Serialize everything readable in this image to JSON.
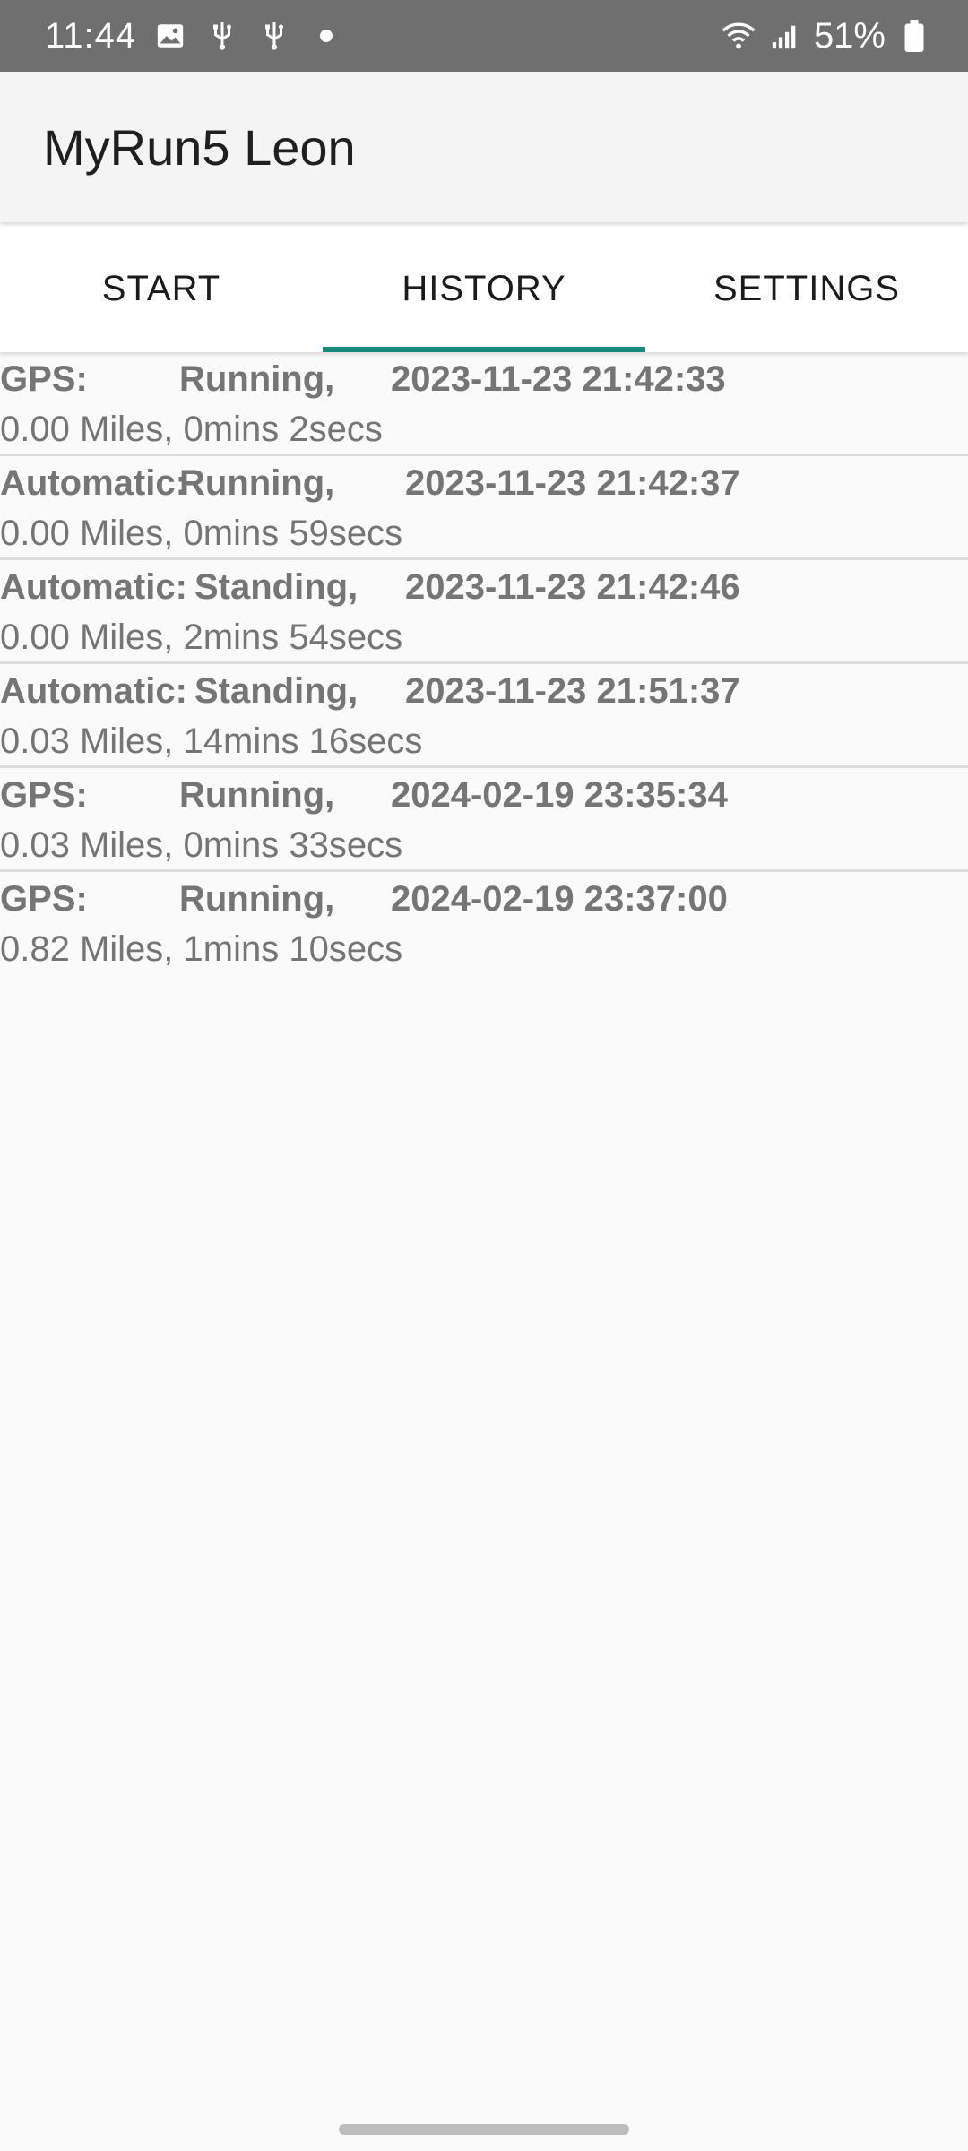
{
  "status_bar": {
    "time": "11:44",
    "battery": "51%",
    "icons": [
      "image-icon",
      "usb-icon",
      "usb-icon",
      "dot-icon",
      "wifi-icon",
      "signal-icon",
      "battery-icon"
    ]
  },
  "app_bar": {
    "title": "MyRun5 Leon"
  },
  "tabs": [
    {
      "label": "START",
      "active": false
    },
    {
      "label": "HISTORY",
      "active": true
    },
    {
      "label": "SETTINGS",
      "active": false
    }
  ],
  "accent_color": "#1a8a7e",
  "history": [
    {
      "type": "GPS:",
      "activity": "Running,",
      "datetime": "2023-11-23 21:42:33",
      "summary": "0.00 Miles, 0mins 2secs"
    },
    {
      "type": "Automatic:",
      "activity": "Running,",
      "datetime": "2023-11-23 21:42:37",
      "summary": "0.00 Miles, 0mins 59secs"
    },
    {
      "type": "Automatic:",
      "activity": "Standing,",
      "datetime": "2023-11-23 21:42:46",
      "summary": "0.00 Miles, 2mins 54secs"
    },
    {
      "type": "Automatic:",
      "activity": "Standing,",
      "datetime": "2023-11-23 21:51:37",
      "summary": "0.03 Miles, 14mins 16secs"
    },
    {
      "type": "GPS:",
      "activity": "Running,",
      "datetime": "2024-02-19 23:35:34",
      "summary": "0.03 Miles, 0mins 33secs"
    },
    {
      "type": "GPS:",
      "activity": "Running,",
      "datetime": "2024-02-19 23:37:00",
      "summary": "0.82 Miles, 1mins 10secs"
    }
  ]
}
